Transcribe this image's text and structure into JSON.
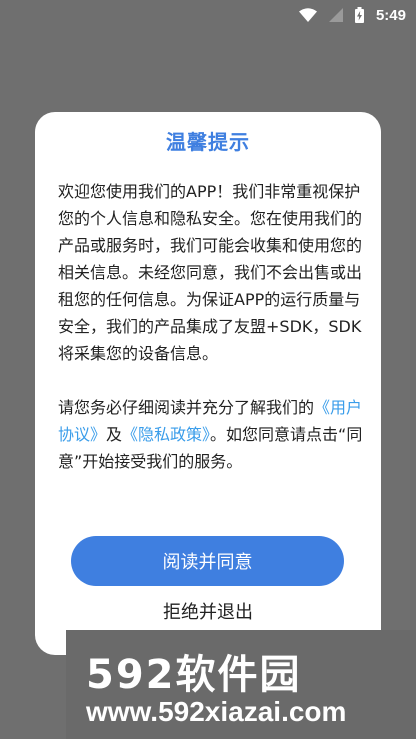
{
  "status_bar": {
    "time": "5:49",
    "icons": [
      "wifi-icon",
      "cellular-signal-icon",
      "battery-charging-icon"
    ]
  },
  "dialog": {
    "title": "温馨提示",
    "paragraph1": "欢迎您使用我们的APP！我们非常重视保护您的个人信息和隐私安全。您在使用我们的产品或服务时，我们可能会收集和使用您的相关信息。未经您同意，我们不会出售或出租您的任何信息。为保证APP的运行质量与安全，我们的产品集成了友盟+SDK，SDK将采集您的设备信息。",
    "paragraph2_before": "请您务必仔细阅读并充分了解我们的",
    "user_agreement_link": "《用户协议》",
    "and_text": "及",
    "privacy_policy_link": "《隐私政策》",
    "paragraph2_after": "。如您同意请点击“同意”开始接受我们的服务。",
    "agree_button": "阅读并同意",
    "reject_button": "拒绝并退出"
  },
  "watermark": {
    "brand": "592软件园",
    "url": "www.592xiazai.com"
  }
}
